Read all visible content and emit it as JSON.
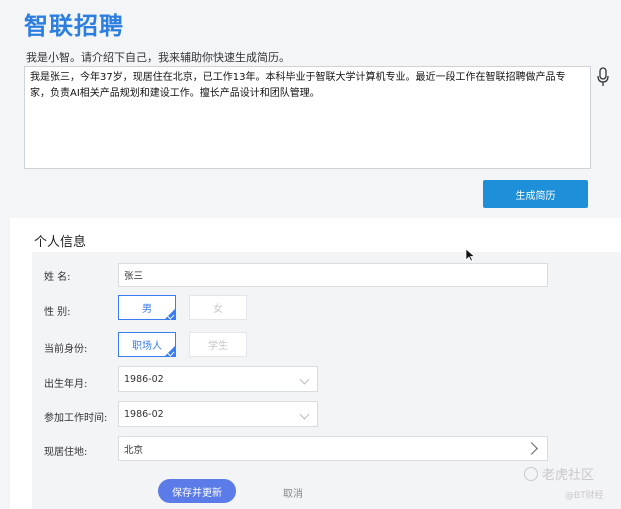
{
  "header": {
    "logo_text": "智联招聘",
    "prompt": "我是小智。请介绍下自己，我来辅助你快速生成简历。",
    "intro_text": "我是张三，今年37岁，现居住在北京，已工作13年。本科毕业于智联大学计算机专业。最近一段工作在智联招聘做产品专家，负责AI相关产品规划和建设工作。擅长产品设计和团队管理。",
    "mic_icon": "microphone-icon",
    "generate_label": "生成简历"
  },
  "personal_info": {
    "title": "个人信息",
    "name_label": "姓  名:",
    "name_value": "张三",
    "gender_label": "性  别:",
    "gender_options": [
      "男",
      "女"
    ],
    "gender_selected": "男",
    "identity_label": "当前身份:",
    "identity_options": [
      "职场人",
      "学生"
    ],
    "identity_selected": "职场人",
    "birth_label": "出生年月:",
    "birth_value": "1986-02",
    "work_start_label": "参加工作时间:",
    "work_start_value": "1986-02",
    "residence_label": "现居住地:",
    "residence_value": "北京",
    "save_label": "保存并更新",
    "cancel_label": "取消"
  },
  "watermark": {
    "line1": "老虎社区",
    "line2": "@BT财经"
  },
  "colors": {
    "brand_blue": "#2c7fe0",
    "generate_button": "#1e8fd9",
    "selected_option": "#3a7df0",
    "save_button": "#5b7be8"
  }
}
